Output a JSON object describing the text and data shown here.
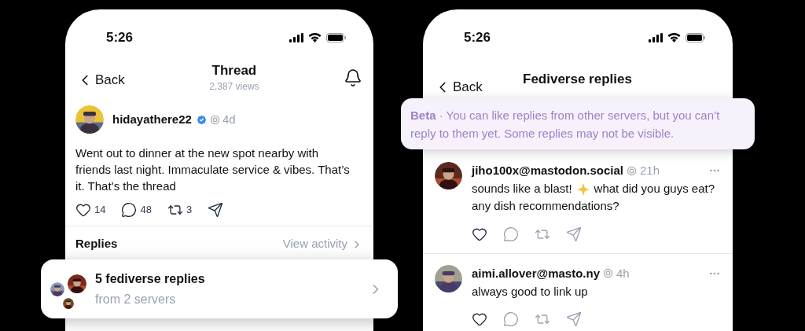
{
  "phones": [
    {
      "status_bar": {
        "time": "5:26"
      },
      "header": {
        "back": "Back",
        "title": "Thread",
        "subtitle": "2,387 views"
      },
      "post": {
        "author": "hidayathere22",
        "verified": true,
        "time": "4d",
        "text": "Went out to dinner at the new spot nearby with friends last night. Immaculate service & vibes. That’s it. That’s the thread",
        "actions": [
          {
            "kind": "like",
            "count": "14"
          },
          {
            "kind": "comment",
            "count": "48"
          },
          {
            "kind": "repost",
            "count": "3"
          },
          {
            "kind": "share"
          }
        ]
      },
      "replies_header": {
        "label": "Replies",
        "link": "View activity"
      },
      "fediverse_card": {
        "title": "5 fediverse replies",
        "subtitle": "from 2 servers"
      }
    },
    {
      "status_bar": {
        "time": "5:26"
      },
      "header": {
        "back": "Back",
        "title": "Fediverse replies"
      },
      "banner": "**Beta** · You can like replies from other servers, but you can’t reply to them yet. Some replies may not be visible.",
      "replies": [
        {
          "author": "jiho100x@mastodon.social",
          "time": "21h",
          "lines": [
            [
              {
                "kind": "text",
                "text": "sounds like a blast!"
              },
              {
                "kind": "emoji"
              },
              {
                "kind": "text",
                "text": "what did you guys eat?"
              }
            ],
            [
              {
                "kind": "text",
                "text": "any dish recommendations?"
              }
            ]
          ],
          "actions": [
            {
              "kind": "like"
            },
            {
              "kind": "comment"
            },
            {
              "kind": "repost"
            },
            {
              "kind": "share"
            }
          ]
        },
        {
          "author": "aimi.allover@masto.ny",
          "time": "4h",
          "lines": [
            [
              {
                "kind": "text",
                "text": "always good to link up"
              }
            ]
          ],
          "actions": [
            {
              "kind": "like"
            },
            {
              "kind": "comment"
            },
            {
              "kind": "repost"
            },
            {
              "kind": "share"
            }
          ]
        }
      ]
    }
  ]
}
